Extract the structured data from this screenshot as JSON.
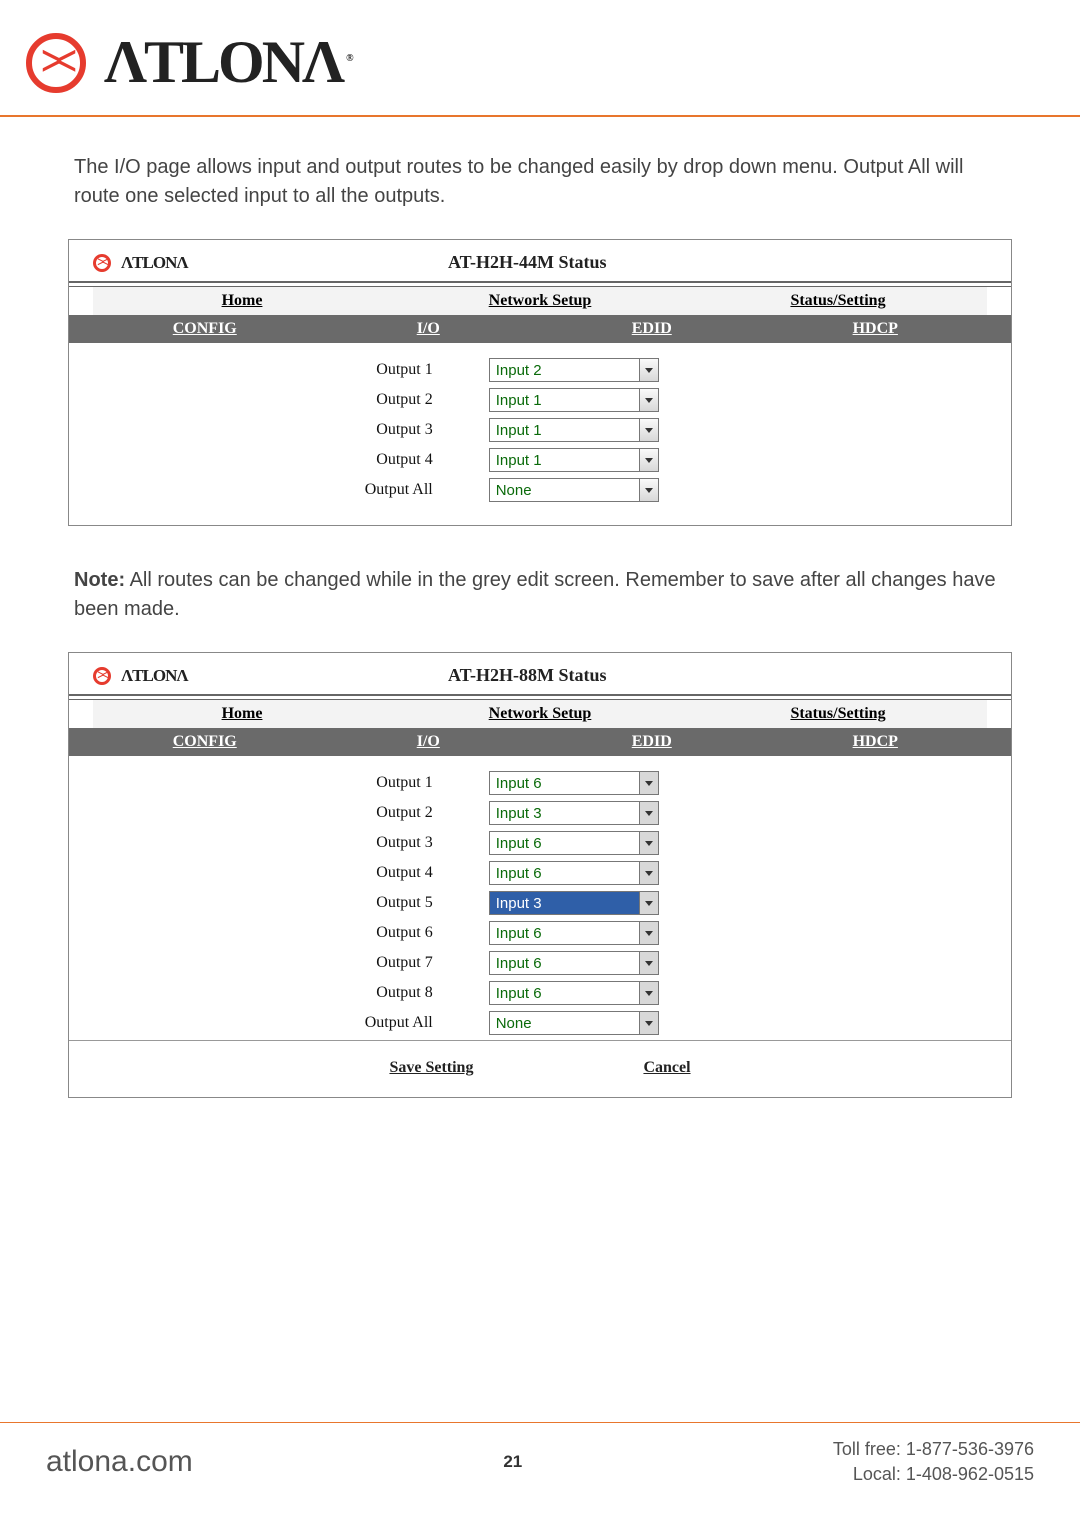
{
  "logo_word": "ΛTLONΛ",
  "intro_paragraph": "The I/O page allows input and output routes to be changed easily by drop down menu. Output All will route one selected input to all the outputs.",
  "note_label": "Note:",
  "note_text": " All routes can be changed while in the grey edit screen. Remember to save after all changes have been made.",
  "tabs_main": {
    "home": "Home",
    "network": "Network Setup",
    "status": "Status/Setting"
  },
  "tabs_sub": {
    "config": "CONFIG",
    "io": "I/O",
    "edid": "EDID",
    "hdcp": "HDCP"
  },
  "panel44": {
    "title": "AT-H2H-44M Status",
    "rows": [
      {
        "out": "Output 1",
        "in": "Input 2"
      },
      {
        "out": "Output 2",
        "in": "Input 1"
      },
      {
        "out": "Output 3",
        "in": "Input 1"
      },
      {
        "out": "Output 4",
        "in": "Input 1"
      },
      {
        "out": "Output All",
        "in": "None"
      }
    ]
  },
  "panel88": {
    "title": "AT-H2H-88M Status",
    "rows": [
      {
        "out": "Output 1",
        "in": "Input 6"
      },
      {
        "out": "Output 2",
        "in": "Input 3"
      },
      {
        "out": "Output 3",
        "in": "Input 6"
      },
      {
        "out": "Output 4",
        "in": "Input 6"
      },
      {
        "out": "Output 5",
        "in": "Input 3",
        "highlight": true
      },
      {
        "out": "Output 6",
        "in": "Input 6"
      },
      {
        "out": "Output 7",
        "in": "Input 6"
      },
      {
        "out": "Output 8",
        "in": "Input 6"
      },
      {
        "out": "Output All",
        "in": "None"
      }
    ],
    "save": "Save Setting",
    "cancel": "Cancel"
  },
  "footer": {
    "site": "atlona.com",
    "page": "21",
    "toll": "Toll free: 1-877-536-3976",
    "local": "Local: 1-408-962-0515"
  }
}
